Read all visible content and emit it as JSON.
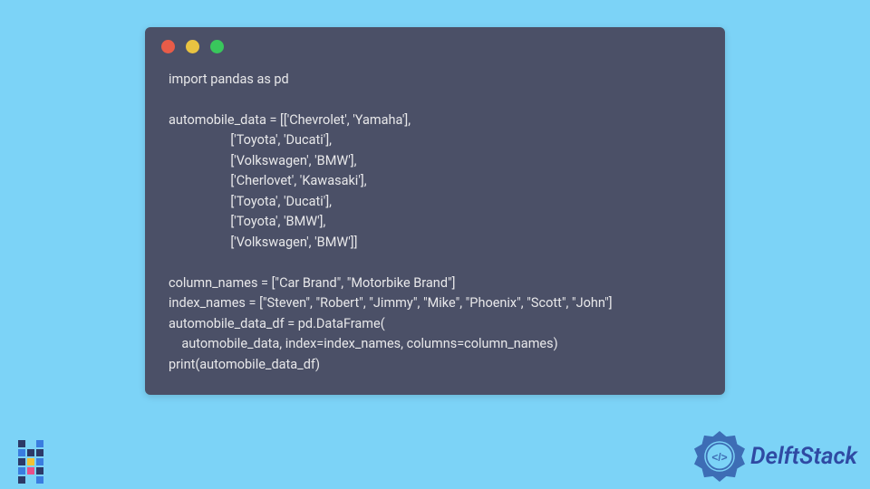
{
  "code": {
    "lines": [
      "import pandas as pd",
      "",
      "automobile_data = [['Chevrolet', 'Yamaha'],",
      "                   ['Toyota', 'Ducati'],",
      "                   ['Volkswagen', 'BMW'],",
      "                   ['Cherlovet', 'Kawasaki'],",
      "                   ['Toyota', 'Ducati'],",
      "                   ['Toyota', 'BMW'],",
      "                   ['Volkswagen', 'BMW']]",
      "",
      "column_names = [\"Car Brand\", \"Motorbike Brand\"]",
      "index_names = [\"Steven\", \"Robert\", \"Jimmy\", \"Mike\", \"Phoenix\", \"Scott\", \"John\"]",
      "automobile_data_df = pd.DataFrame(",
      "    automobile_data, index=index_names, columns=column_names)",
      "print(automobile_data_df)"
    ]
  },
  "branding": {
    "right_text": "DelftStack"
  }
}
